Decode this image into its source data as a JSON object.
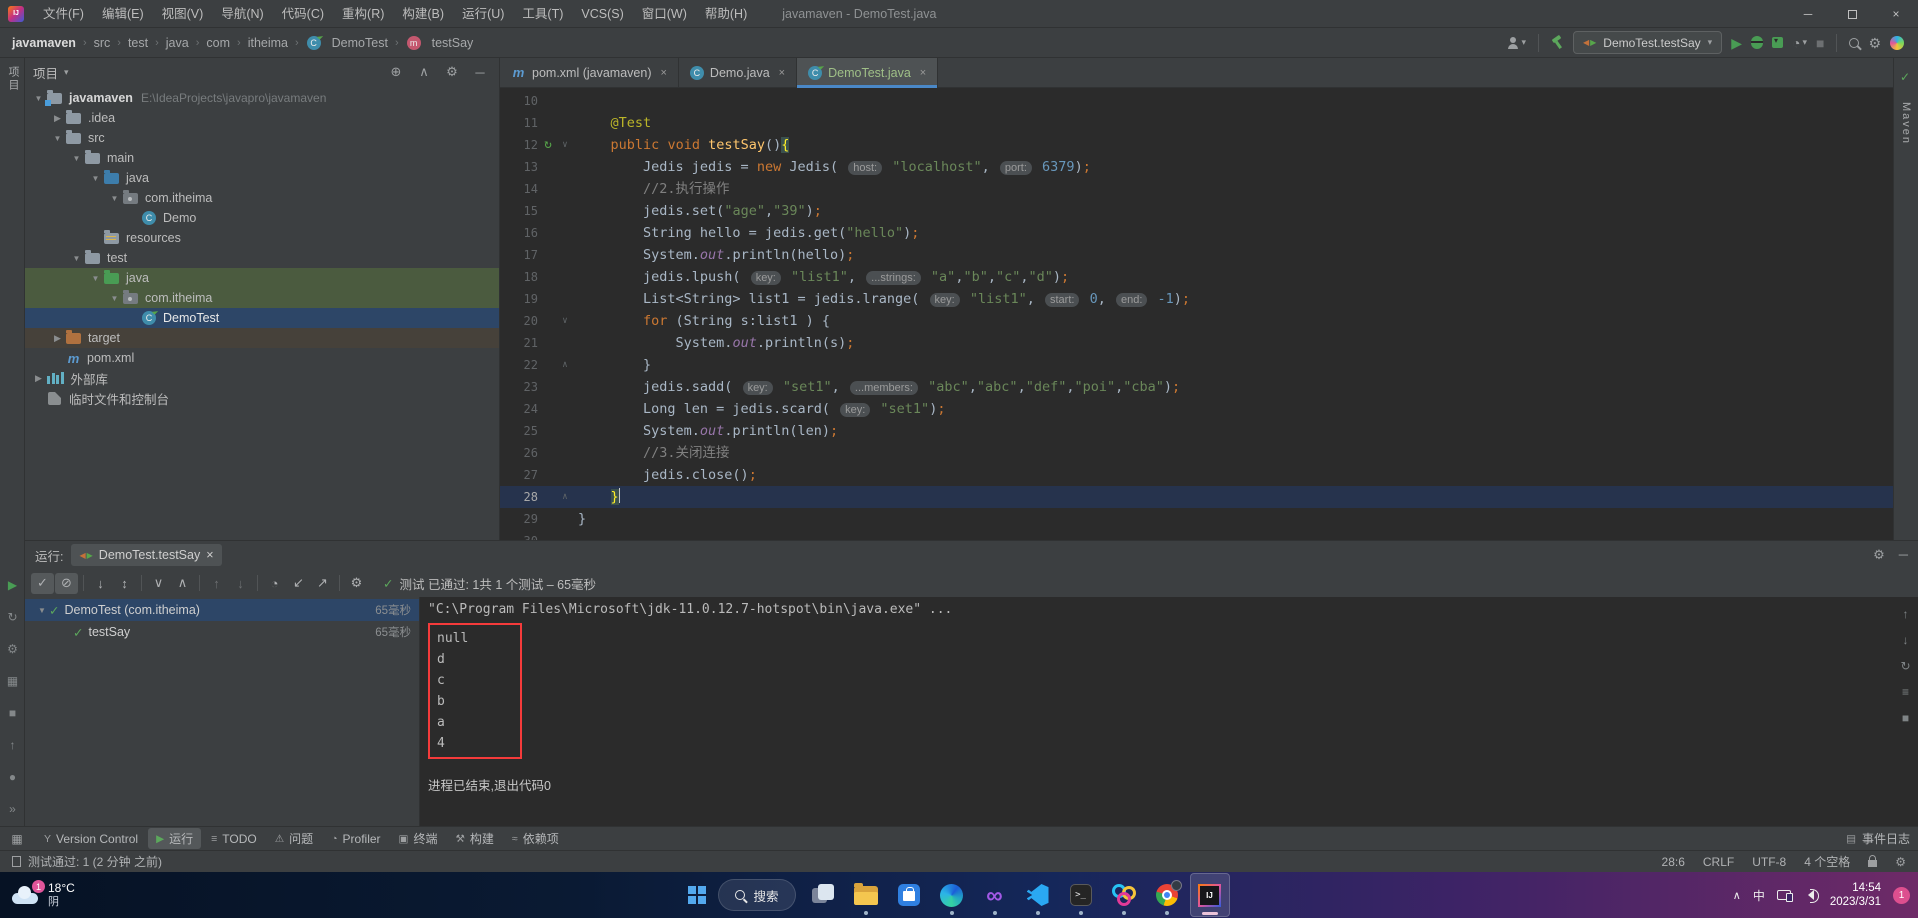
{
  "titlebar": {
    "title": "javamaven - DemoTest.java",
    "menus": [
      "文件(F)",
      "编辑(E)",
      "视图(V)",
      "导航(N)",
      "代码(C)",
      "重构(R)",
      "构建(B)",
      "运行(U)",
      "工具(T)",
      "VCS(S)",
      "窗口(W)",
      "帮助(H)"
    ]
  },
  "navbar": {
    "breadcrumbs": [
      {
        "label": "javamaven",
        "bold": true
      },
      {
        "label": "src"
      },
      {
        "label": "test"
      },
      {
        "label": "java"
      },
      {
        "label": "com"
      },
      {
        "label": "itheima"
      },
      {
        "label": "DemoTest",
        "icon": "class-icon"
      },
      {
        "label": "testSay",
        "icon": "method-icon"
      }
    ],
    "run_config": "DemoTest.testSay",
    "right_icons": [
      "users-icon",
      "hammer-icon",
      "run-icon",
      "debug-icon",
      "coverage-icon",
      "profiler-icon",
      "stop-icon",
      "search-icon",
      "settings-icon",
      "gradient-ball-icon"
    ]
  },
  "left_stripe": {
    "top_label": "项目",
    "bottom_icons": [
      "run-icon",
      "rerun-icon",
      "settings-icon",
      "grid-icon",
      "stop-icon",
      "up-icon",
      "record-icon",
      "more-icon"
    ]
  },
  "right_stripe": {
    "label": "Maven",
    "check": "✓"
  },
  "project": {
    "header": "项目",
    "header_icons": [
      "locate-icon",
      "collapse-all-icon",
      "settings-icon",
      "hide-icon"
    ],
    "rows": [
      {
        "d": 0,
        "a": "v",
        "ic": "root",
        "l": "javamaven",
        "sub": "E:\\IdeaProjects\\javapro\\javamaven"
      },
      {
        "d": 1,
        "a": ">",
        "ic": "dir",
        "l": ".idea"
      },
      {
        "d": 1,
        "a": "v",
        "ic": "dir",
        "l": "src"
      },
      {
        "d": 2,
        "a": "v",
        "ic": "dir",
        "l": "main"
      },
      {
        "d": 3,
        "a": "v",
        "ic": "dirb",
        "l": "java"
      },
      {
        "d": 4,
        "a": "v",
        "ic": "pkg",
        "l": "com.itheima"
      },
      {
        "d": 5,
        "a": "",
        "ic": "cls",
        "l": "Demo"
      },
      {
        "d": 3,
        "a": "",
        "ic": "dirr",
        "l": "resources"
      },
      {
        "d": 2,
        "a": "v",
        "ic": "dir",
        "l": "test"
      },
      {
        "d": 3,
        "a": "v",
        "ic": "dirg",
        "l": "java",
        "sel": "g"
      },
      {
        "d": 4,
        "a": "v",
        "ic": "pkg",
        "l": "com.itheima",
        "sel": "g"
      },
      {
        "d": 5,
        "a": "",
        "ic": "clst",
        "l": "DemoTest",
        "sel": "b"
      },
      {
        "d": 1,
        "a": ">",
        "ic": "diro",
        "l": "target",
        "sel": "t"
      },
      {
        "d": 1,
        "a": "",
        "ic": "mvn",
        "l": "pom.xml"
      },
      {
        "d": 0,
        "a": ">",
        "ic": "lib",
        "l": "外部库"
      },
      {
        "d": 0,
        "a": "",
        "ic": "scr",
        "l": "临时文件和控制台"
      }
    ]
  },
  "editor": {
    "tabs": [
      {
        "label": "pom.xml (javamaven)",
        "icon": "maven-icon",
        "active": false
      },
      {
        "label": "Demo.java",
        "icon": "class-icon",
        "active": false
      },
      {
        "label": "DemoTest.java",
        "icon": "test-class-icon",
        "active": true
      }
    ],
    "lines": [
      {
        "n": 10,
        "t": []
      },
      {
        "n": 11,
        "t": [
          [
            "p",
            "    "
          ],
          [
            "a",
            "@Test"
          ]
        ]
      },
      {
        "n": 12,
        "g": "run",
        "f": "v",
        "t": [
          [
            "p",
            "    "
          ],
          [
            "k",
            "public"
          ],
          [
            "p",
            " "
          ],
          [
            "k",
            "void"
          ],
          [
            "p",
            " "
          ],
          [
            "m",
            "testSay"
          ],
          [
            "p",
            "()"
          ],
          [
            "b",
            "{"
          ]
        ]
      },
      {
        "n": 13,
        "t": [
          [
            "p",
            "        Jedis jedis = "
          ],
          [
            "k",
            "new"
          ],
          [
            "p",
            " Jedis( "
          ],
          [
            "h",
            "host:"
          ],
          [
            "s",
            " \"localhost\""
          ],
          [
            "p",
            ", "
          ],
          [
            "h",
            "port:"
          ],
          [
            "n",
            " 6379"
          ],
          [
            "p",
            ")"
          ],
          [
            "k",
            ";"
          ]
        ]
      },
      {
        "n": 14,
        "t": [
          [
            "c",
            "        //2.执行操作"
          ]
        ]
      },
      {
        "n": 15,
        "t": [
          [
            "p",
            "        jedis.set("
          ],
          [
            "s",
            "\"age\""
          ],
          [
            "p",
            ","
          ],
          [
            "s",
            "\"39\""
          ],
          [
            "p",
            ")"
          ],
          [
            "k",
            ";"
          ]
        ]
      },
      {
        "n": 16,
        "t": [
          [
            "p",
            "        String hello = jedis.get("
          ],
          [
            "s",
            "\"hello\""
          ],
          [
            "p",
            ")"
          ],
          [
            "k",
            ";"
          ]
        ]
      },
      {
        "n": 17,
        "t": [
          [
            "p",
            "        System."
          ],
          [
            "i",
            "out"
          ],
          [
            "p",
            ".println(hello)"
          ],
          [
            "k",
            ";"
          ]
        ]
      },
      {
        "n": 18,
        "t": [
          [
            "p",
            "        jedis.lpush( "
          ],
          [
            "h",
            "key:"
          ],
          [
            "s",
            " \"list1\""
          ],
          [
            "p",
            ", "
          ],
          [
            "h",
            "...strings:"
          ],
          [
            "s",
            " \"a\""
          ],
          [
            "p",
            ","
          ],
          [
            "s",
            "\"b\""
          ],
          [
            "p",
            ","
          ],
          [
            "s",
            "\"c\""
          ],
          [
            "p",
            ","
          ],
          [
            "s",
            "\"d\""
          ],
          [
            "p",
            ")"
          ],
          [
            "k",
            ";"
          ]
        ]
      },
      {
        "n": 19,
        "t": [
          [
            "p",
            "        List<String> list1 = jedis.lrange( "
          ],
          [
            "h",
            "key:"
          ],
          [
            "s",
            " \"list1\""
          ],
          [
            "p",
            ", "
          ],
          [
            "h",
            "start:"
          ],
          [
            "n",
            " 0"
          ],
          [
            "p",
            ", "
          ],
          [
            "h",
            "end:"
          ],
          [
            "n",
            " -1"
          ],
          [
            "p",
            ")"
          ],
          [
            "k",
            ";"
          ]
        ]
      },
      {
        "n": 20,
        "f": "v",
        "t": [
          [
            "p",
            "        "
          ],
          [
            "k",
            "for"
          ],
          [
            "p",
            " (String s:list1 ) {"
          ]
        ]
      },
      {
        "n": 21,
        "t": [
          [
            "p",
            "            System."
          ],
          [
            "i",
            "out"
          ],
          [
            "p",
            ".println(s)"
          ],
          [
            "k",
            ";"
          ]
        ]
      },
      {
        "n": 22,
        "f": "^",
        "t": [
          [
            "p",
            "        }"
          ]
        ]
      },
      {
        "n": 23,
        "t": [
          [
            "p",
            "        jedis.sadd( "
          ],
          [
            "h",
            "key:"
          ],
          [
            "s",
            " \"set1\""
          ],
          [
            "p",
            ", "
          ],
          [
            "h",
            "...members:"
          ],
          [
            "s",
            " \"abc\""
          ],
          [
            "p",
            ","
          ],
          [
            "s",
            "\"abc\""
          ],
          [
            "p",
            ","
          ],
          [
            "s",
            "\"def\""
          ],
          [
            "p",
            ","
          ],
          [
            "s",
            "\"poi\""
          ],
          [
            "p",
            ","
          ],
          [
            "s",
            "\"cba\""
          ],
          [
            "p",
            ")"
          ],
          [
            "k",
            ";"
          ]
        ]
      },
      {
        "n": 24,
        "t": [
          [
            "p",
            "        Long len = jedis.scard( "
          ],
          [
            "h",
            "key:"
          ],
          [
            "s",
            " \"set1\""
          ],
          [
            "p",
            ")"
          ],
          [
            "k",
            ";"
          ]
        ]
      },
      {
        "n": 25,
        "t": [
          [
            "p",
            "        System."
          ],
          [
            "i",
            "out"
          ],
          [
            "p",
            ".println(len)"
          ],
          [
            "k",
            ";"
          ]
        ]
      },
      {
        "n": 26,
        "t": [
          [
            "c",
            "        //3.关闭连接"
          ]
        ]
      },
      {
        "n": 27,
        "t": [
          [
            "p",
            "        jedis.close()"
          ],
          [
            "k",
            ";"
          ]
        ]
      },
      {
        "n": 28,
        "cur": true,
        "f": "^",
        "t": [
          [
            "p",
            "    "
          ],
          [
            "b",
            "}"
          ],
          [
            "caret",
            ""
          ]
        ]
      },
      {
        "n": 29,
        "t": [
          [
            "p",
            "}"
          ]
        ]
      },
      {
        "n": 30,
        "t": []
      }
    ]
  },
  "runpanel": {
    "tab_prefix": "运行:",
    "tab_label": "DemoTest.testSay",
    "status": "测试 已通过: 1共 1 个测试 – 65毫秒",
    "toolbar_icons": [
      "filter-passed-icon",
      "filter-ignored-icon",
      "sep",
      "sort-alpha-icon",
      "sort-duration-icon",
      "sep",
      "expand-all-icon",
      "collapse-all-icon",
      "sep",
      "prev-failed-icon",
      "next-failed-icon",
      "sep",
      "history-icon",
      "import-results-icon",
      "export-results-icon",
      "sep",
      "settings-icon"
    ],
    "tree": [
      {
        "name": "DemoTest (com.itheima)",
        "time": "65毫秒",
        "selected": true,
        "arrow": "v"
      },
      {
        "name": "testSay",
        "time": "65毫秒",
        "selected": false,
        "arrow": ""
      }
    ],
    "console": {
      "cmd": "\"C:\\Program Files\\Microsoft\\jdk-11.0.12.7-hotspot\\bin\\java.exe\" ...",
      "outputs": [
        "null",
        "d",
        "c",
        "b",
        "a",
        "4"
      ],
      "exit": "进程已结束,退出代码0"
    },
    "right_icons": [
      "scroll-up-icon",
      "scroll-down-icon",
      "soft-wrap-icon",
      "list-icon",
      "clear-icon"
    ]
  },
  "bottombar": {
    "items": [
      {
        "label": "Version Control",
        "icon": "branch-icon"
      },
      {
        "label": "运行",
        "icon": "run-icon",
        "active": true
      },
      {
        "label": "TODO",
        "icon": "todo-icon"
      },
      {
        "label": "问题",
        "icon": "problems-icon"
      },
      {
        "label": "Profiler",
        "icon": "profiler-icon"
      },
      {
        "label": "终端",
        "icon": "terminal-icon"
      },
      {
        "label": "构建",
        "icon": "build-icon"
      },
      {
        "label": "依赖项",
        "icon": "dependencies-icon"
      }
    ],
    "right_label": "事件日志"
  },
  "statusbar": {
    "left": "测试通过: 1 (2 分钟 之前)",
    "right": [
      "28:6",
      "CRLF",
      "UTF-8",
      "4 个空格"
    ]
  },
  "taskbar": {
    "weather": {
      "temp": "18°C",
      "desc": "阴",
      "badge": "1"
    },
    "search": "搜索",
    "apps": [
      {
        "kind": "taskview",
        "name": "task-view-icon",
        "dot": false
      },
      {
        "kind": "explorer",
        "name": "file-explorer-icon",
        "dot": true
      },
      {
        "kind": "store",
        "name": "microsoft-store-icon",
        "dot": false
      },
      {
        "kind": "edge",
        "name": "edge-icon",
        "dot": true
      },
      {
        "kind": "vs",
        "name": "visual-studio-icon",
        "dot": true,
        "glyph": "∞"
      },
      {
        "kind": "vscode",
        "name": "vs-code-icon",
        "dot": true
      },
      {
        "kind": "terminal",
        "name": "terminal-icon",
        "dot": true,
        "glyph": ">_"
      },
      {
        "kind": "rings",
        "name": "rings-app-icon",
        "dot": true
      },
      {
        "kind": "chrome",
        "name": "chrome-icon",
        "dot": true
      },
      {
        "kind": "idea",
        "name": "intellij-idea-icon",
        "dot": false,
        "active": true,
        "glyph": "IJ"
      }
    ],
    "tray": {
      "hidden": "∧",
      "ime": "中",
      "time": "14:54",
      "date": "2023/3/31",
      "badge": "1"
    }
  }
}
